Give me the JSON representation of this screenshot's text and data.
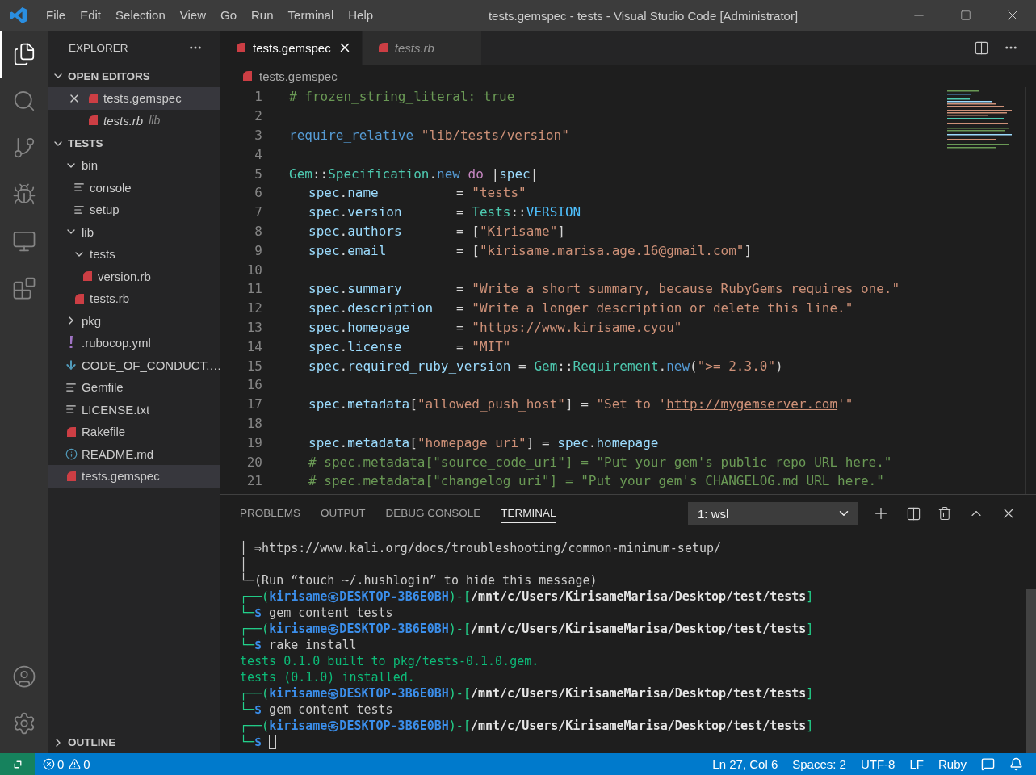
{
  "title_bar": {
    "menus": [
      "File",
      "Edit",
      "Selection",
      "View",
      "Go",
      "Run",
      "Terminal",
      "Help"
    ],
    "title": "tests.gemspec - tests - Visual Studio Code [Administrator]"
  },
  "activity_bar": {
    "top": [
      {
        "kind": "files",
        "selected": true
      },
      {
        "kind": "search",
        "selected": false
      },
      {
        "kind": "source-control",
        "selected": false
      },
      {
        "kind": "debug",
        "selected": false
      },
      {
        "kind": "remote",
        "selected": false
      },
      {
        "kind": "extensions",
        "selected": false
      }
    ],
    "bottom": [
      {
        "kind": "account",
        "selected": false
      },
      {
        "kind": "settings",
        "selected": false
      }
    ]
  },
  "sidebar": {
    "title": "EXPLORER",
    "open_editors": {
      "title": "OPEN EDITORS",
      "expanded": true,
      "items": [
        {
          "name": "tests.gemspec",
          "selected": true,
          "preview": false
        },
        {
          "name": "tests.rb",
          "description": "lib",
          "selected": false,
          "preview": true
        }
      ]
    },
    "folder": {
      "title": "TESTS",
      "expanded": true,
      "tree": [
        {
          "name": "bin",
          "kind": "folder",
          "expanded": true,
          "selected": false,
          "children": [
            {
              "name": "console",
              "kind": "text",
              "selected": false
            },
            {
              "name": "setup",
              "kind": "text",
              "selected": false
            }
          ]
        },
        {
          "name": "lib",
          "kind": "folder",
          "expanded": true,
          "selected": false,
          "children": [
            {
              "name": "tests",
              "kind": "folder",
              "expanded": true,
              "selected": false,
              "children": [
                {
                  "name": "version.rb",
                  "kind": "ruby",
                  "selected": false
                }
              ]
            },
            {
              "name": "tests.rb",
              "kind": "ruby",
              "selected": false
            }
          ]
        },
        {
          "name": "pkg",
          "kind": "folder",
          "expanded": false,
          "selected": false
        },
        {
          "name": ".rubocop.yml",
          "kind": "yaml",
          "selected": false
        },
        {
          "name": "CODE_OF_CONDUCT.…",
          "kind": "download",
          "selected": false
        },
        {
          "name": "Gemfile",
          "kind": "text",
          "selected": false
        },
        {
          "name": "LICENSE.txt",
          "kind": "text",
          "selected": false
        },
        {
          "name": "Rakefile",
          "kind": "ruby",
          "selected": false
        },
        {
          "name": "README.md",
          "kind": "info",
          "selected": false
        },
        {
          "name": "tests.gemspec",
          "kind": "ruby",
          "selected": true
        }
      ]
    },
    "outline": {
      "title": "OUTLINE",
      "expanded": false
    }
  },
  "editor": {
    "tabs": [
      {
        "name": "tests.gemspec",
        "selected": true,
        "preview": false
      },
      {
        "name": "tests.rb",
        "selected": false,
        "preview": true
      }
    ],
    "breadcrumb": "tests.gemspec",
    "lines": [
      {
        "n": "1",
        "indent": false,
        "tokens": [
          {
            "kind": "comment",
            "t": "# frozen_string_literal: true"
          }
        ]
      },
      {
        "n": "2",
        "indent": false
      },
      {
        "n": "3",
        "indent": false,
        "tokens": [
          {
            "kind": "func",
            "t": "require_relative"
          },
          {
            "kind": "string",
            "t": " \"lib/tests/version\""
          }
        ]
      },
      {
        "n": "4",
        "indent": false
      },
      {
        "n": "5",
        "indent": false,
        "tokens": [
          {
            "kind": "type",
            "t": "Gem"
          },
          {
            "kind": "punct",
            "t": "::"
          },
          {
            "kind": "type",
            "t": "Specification"
          },
          {
            "kind": "punct",
            "t": "."
          },
          {
            "kind": "func",
            "t": "new"
          },
          {
            "kind": "keyword",
            "t": " do"
          },
          {
            "kind": "punct",
            "t": " |"
          },
          {
            "kind": "var",
            "t": "spec"
          },
          {
            "kind": "punct",
            "t": "|"
          }
        ]
      },
      {
        "n": "6",
        "indent": true,
        "tokens": [
          {
            "kind": "var",
            "t": "spec"
          },
          {
            "kind": "punct",
            "t": "."
          },
          {
            "kind": "var",
            "t": "name"
          },
          {
            "kind": "punct",
            "t": "          = "
          },
          {
            "kind": "string",
            "t": "\"tests\""
          }
        ]
      },
      {
        "n": "7",
        "indent": true,
        "tokens": [
          {
            "kind": "var",
            "t": "spec"
          },
          {
            "kind": "punct",
            "t": "."
          },
          {
            "kind": "var",
            "t": "version"
          },
          {
            "kind": "punct",
            "t": "       = "
          },
          {
            "kind": "type",
            "t": "Tests"
          },
          {
            "kind": "punct",
            "t": "::"
          },
          {
            "kind": "const",
            "t": "VERSION"
          }
        ]
      },
      {
        "n": "8",
        "indent": true,
        "tokens": [
          {
            "kind": "var",
            "t": "spec"
          },
          {
            "kind": "punct",
            "t": "."
          },
          {
            "kind": "var",
            "t": "authors"
          },
          {
            "kind": "punct",
            "t": "       = ["
          },
          {
            "kind": "string",
            "t": "\"Kirisame\""
          },
          {
            "kind": "punct",
            "t": "]"
          }
        ]
      },
      {
        "n": "9",
        "indent": true,
        "tokens": [
          {
            "kind": "var",
            "t": "spec"
          },
          {
            "kind": "punct",
            "t": "."
          },
          {
            "kind": "var",
            "t": "email"
          },
          {
            "kind": "punct",
            "t": "         = ["
          },
          {
            "kind": "string",
            "t": "\"kirisame.marisa.age.16@gmail.com\""
          },
          {
            "kind": "punct",
            "t": "]"
          }
        ]
      },
      {
        "n": "10",
        "indent": true
      },
      {
        "n": "11",
        "indent": true,
        "tokens": [
          {
            "kind": "var",
            "t": "spec"
          },
          {
            "kind": "punct",
            "t": "."
          },
          {
            "kind": "var",
            "t": "summary"
          },
          {
            "kind": "punct",
            "t": "       = "
          },
          {
            "kind": "string",
            "t": "\"Write a short summary, because RubyGems requires one.\""
          }
        ]
      },
      {
        "n": "12",
        "indent": true,
        "tokens": [
          {
            "kind": "var",
            "t": "spec"
          },
          {
            "kind": "punct",
            "t": "."
          },
          {
            "kind": "var",
            "t": "description"
          },
          {
            "kind": "punct",
            "t": "   = "
          },
          {
            "kind": "string",
            "t": "\"Write a longer description or delete this line.\""
          }
        ]
      },
      {
        "n": "13",
        "indent": true,
        "tokens": [
          {
            "kind": "var",
            "t": "spec"
          },
          {
            "kind": "punct",
            "t": "."
          },
          {
            "kind": "var",
            "t": "homepage"
          },
          {
            "kind": "punct",
            "t": "      = "
          },
          {
            "kind": "string",
            "t": "\""
          },
          {
            "kind": "link",
            "t": "https://www.kirisame.cyou"
          },
          {
            "kind": "string",
            "t": "\""
          }
        ]
      },
      {
        "n": "14",
        "indent": true,
        "tokens": [
          {
            "kind": "var",
            "t": "spec"
          },
          {
            "kind": "punct",
            "t": "."
          },
          {
            "kind": "var",
            "t": "license"
          },
          {
            "kind": "punct",
            "t": "       = "
          },
          {
            "kind": "string",
            "t": "\"MIT\""
          }
        ]
      },
      {
        "n": "15",
        "indent": true,
        "tokens": [
          {
            "kind": "var",
            "t": "spec"
          },
          {
            "kind": "punct",
            "t": "."
          },
          {
            "kind": "var",
            "t": "required_ruby_version"
          },
          {
            "kind": "punct",
            "t": " = "
          },
          {
            "kind": "type",
            "t": "Gem"
          },
          {
            "kind": "punct",
            "t": "::"
          },
          {
            "kind": "type",
            "t": "Requirement"
          },
          {
            "kind": "punct",
            "t": "."
          },
          {
            "kind": "func",
            "t": "new"
          },
          {
            "kind": "punct",
            "t": "("
          },
          {
            "kind": "string",
            "t": "\">= 2.3.0\""
          },
          {
            "kind": "punct",
            "t": ")"
          }
        ]
      },
      {
        "n": "16",
        "indent": true
      },
      {
        "n": "17",
        "indent": true,
        "tokens": [
          {
            "kind": "var",
            "t": "spec"
          },
          {
            "kind": "punct",
            "t": "."
          },
          {
            "kind": "var",
            "t": "metadata"
          },
          {
            "kind": "punct",
            "t": "["
          },
          {
            "kind": "string",
            "t": "\"allowed_push_host\""
          },
          {
            "kind": "punct",
            "t": "] = "
          },
          {
            "kind": "string",
            "t": "\"Set to '"
          },
          {
            "kind": "link",
            "t": "http://mygemserver.com"
          },
          {
            "kind": "string",
            "t": "'\""
          }
        ]
      },
      {
        "n": "18",
        "indent": true
      },
      {
        "n": "19",
        "indent": true,
        "tokens": [
          {
            "kind": "var",
            "t": "spec"
          },
          {
            "kind": "punct",
            "t": "."
          },
          {
            "kind": "var",
            "t": "metadata"
          },
          {
            "kind": "punct",
            "t": "["
          },
          {
            "kind": "string",
            "t": "\"homepage_uri\""
          },
          {
            "kind": "punct",
            "t": "] = "
          },
          {
            "kind": "var",
            "t": "spec"
          },
          {
            "kind": "punct",
            "t": "."
          },
          {
            "kind": "var",
            "t": "homepage"
          }
        ]
      },
      {
        "n": "20",
        "indent": true,
        "tokens": [
          {
            "kind": "comment",
            "t": "# spec.metadata[\"source_code_uri\"] = \"Put your gem's public repo URL here.\""
          }
        ]
      },
      {
        "n": "21",
        "indent": true,
        "tokens": [
          {
            "kind": "comment",
            "t": "# spec.metadata[\"changelog_uri\"] = \"Put your gem's CHANGELOG.md URL here.\""
          }
        ]
      }
    ]
  },
  "panel": {
    "tabs": [
      {
        "label": "PROBLEMS",
        "selected": false
      },
      {
        "label": "OUTPUT",
        "selected": false
      },
      {
        "label": "DEBUG CONSOLE",
        "selected": false
      },
      {
        "label": "TERMINAL",
        "selected": true
      }
    ],
    "terminal_select": "1: wsl",
    "terminal": [
      {
        "cursor": false,
        "segs": [
          {
            "kind": "text",
            "t": "│ ⇒https://www.kali.org/docs/troubleshooting/common-minimum-setup/"
          }
        ]
      },
      {
        "cursor": false,
        "segs": [
          {
            "kind": "text",
            "t": "│"
          }
        ]
      },
      {
        "cursor": false,
        "segs": [
          {
            "kind": "text",
            "t": "└─(Run “touch ~/.hushlogin” to hide this message)"
          }
        ]
      },
      {
        "cursor": false,
        "segs": [
          {
            "kind": "frame",
            "t": "┌──("
          },
          {
            "kind": "user",
            "t": "kirisame㉿DESKTOP-3B6E0BH"
          },
          {
            "kind": "frame",
            "t": ")-["
          },
          {
            "kind": "path",
            "t": "/mnt/c/Users/KirisameMarisa/Desktop/test/tests"
          },
          {
            "kind": "frame",
            "t": "]"
          }
        ]
      },
      {
        "cursor": false,
        "segs": [
          {
            "kind": "frame",
            "t": "└─"
          },
          {
            "kind": "user",
            "t": "$"
          },
          {
            "kind": "text",
            "t": " gem content tests"
          }
        ]
      },
      {
        "cursor": false,
        "segs": [
          {
            "kind": "frame",
            "t": "┌──("
          },
          {
            "kind": "user",
            "t": "kirisame㉿DESKTOP-3B6E0BH"
          },
          {
            "kind": "frame",
            "t": ")-["
          },
          {
            "kind": "path",
            "t": "/mnt/c/Users/KirisameMarisa/Desktop/test/tests"
          },
          {
            "kind": "frame",
            "t": "]"
          }
        ]
      },
      {
        "cursor": false,
        "segs": [
          {
            "kind": "frame",
            "t": "└─"
          },
          {
            "kind": "user",
            "t": "$"
          },
          {
            "kind": "text",
            "t": " rake install"
          }
        ]
      },
      {
        "cursor": false,
        "segs": [
          {
            "kind": "output",
            "t": "tests 0.1.0 built to pkg/tests-0.1.0.gem."
          }
        ]
      },
      {
        "cursor": false,
        "segs": [
          {
            "kind": "output",
            "t": "tests (0.1.0) installed."
          }
        ]
      },
      {
        "cursor": false,
        "segs": [
          {
            "kind": "frame",
            "t": "┌──("
          },
          {
            "kind": "user",
            "t": "kirisame㉿DESKTOP-3B6E0BH"
          },
          {
            "kind": "frame",
            "t": ")-["
          },
          {
            "kind": "path",
            "t": "/mnt/c/Users/KirisameMarisa/Desktop/test/tests"
          },
          {
            "kind": "frame",
            "t": "]"
          }
        ]
      },
      {
        "cursor": false,
        "segs": [
          {
            "kind": "frame",
            "t": "└─"
          },
          {
            "kind": "user",
            "t": "$"
          },
          {
            "kind": "text",
            "t": " gem content tests"
          }
        ]
      },
      {
        "cursor": false,
        "segs": [
          {
            "kind": "frame",
            "t": "┌──("
          },
          {
            "kind": "user",
            "t": "kirisame㉿DESKTOP-3B6E0BH"
          },
          {
            "kind": "frame",
            "t": ")-["
          },
          {
            "kind": "path",
            "t": "/mnt/c/Users/KirisameMarisa/Desktop/test/tests"
          },
          {
            "kind": "frame",
            "t": "]"
          }
        ]
      },
      {
        "cursor": true,
        "segs": [
          {
            "kind": "frame",
            "t": "└─"
          },
          {
            "kind": "user",
            "t": "$"
          }
        ]
      }
    ]
  },
  "status_bar": {
    "errors": "0",
    "warnings": "0",
    "items": [
      "Ln 27, Col 6",
      "Spaces: 2",
      "UTF-8",
      "LF",
      "Ruby"
    ]
  }
}
